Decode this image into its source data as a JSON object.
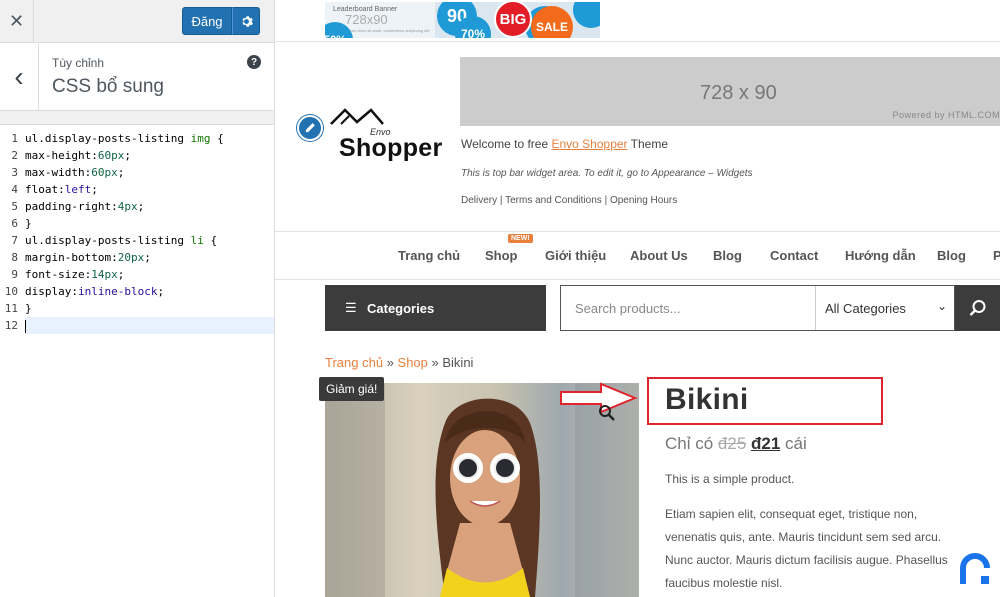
{
  "customizer": {
    "close_glyph": "✕",
    "publish_label": "Đăng",
    "breadcrumb": "Tùy chỉnh",
    "section_title": "CSS bổ sung",
    "help_glyph": "?",
    "back_glyph": "‹"
  },
  "css_editor": {
    "line_numbers": [
      "1",
      "2",
      "3",
      "4",
      "5",
      "6",
      "7",
      "8",
      "9",
      "10",
      "11",
      "12"
    ],
    "lines": [
      "ul.display-posts-listing img {",
      "max-height:60px;",
      "max-width:60px;",
      "float:left;",
      "padding-right:4px;",
      "}",
      "ul.display-posts-listing li {",
      "margin-bottom:20px;",
      "font-size:14px;",
      "display:inline-block;",
      "}",
      ""
    ],
    "current_line": 12
  },
  "preview": {
    "leaderboard": {
      "title": "Leaderboard Banner",
      "size": "728x90",
      "fine_print": "Lorem ipsum dolor sit amet, consectetur adipiscing elit.",
      "discounts": [
        "50%",
        "90",
        "70%",
        "BIG",
        "SALE",
        "%"
      ]
    },
    "logo": {
      "brand": "Shopper",
      "envo": "Envo"
    },
    "header_banner": {
      "size": "728 x 90",
      "credit": "Powered by HTML.COM"
    },
    "welcome": {
      "prefix": "Welcome to free ",
      "link": "Envo Shopper",
      "suffix": " Theme"
    },
    "topbar_note": "This is top bar widget area. To edit it, go to Appearance – Widgets",
    "top_links": "Delivery | Terms and Conditions | Opening Hours",
    "nav": {
      "items": [
        "Trang chủ",
        "Shop",
        "Giới thiệu",
        "About Us",
        "Blog",
        "Contact",
        "Hướng dẫn",
        "Blog",
        "P"
      ],
      "badge": "NEW!"
    },
    "categories_label": "Categories",
    "search": {
      "placeholder": "Search products...",
      "category_select": "All Categories"
    },
    "breadcrumb": {
      "home": "Trang chủ",
      "sep1": " » ",
      "shop": "Shop",
      "sep2": " » ",
      "current": "Bikini"
    },
    "product": {
      "sale_badge": "Giảm giá!",
      "title": "Bikini",
      "price_prefix": "Chỉ có ",
      "old_price": "đ25",
      "new_price": "đ21",
      "price_suffix": " cái",
      "short_description": "This is a simple product.",
      "long_description": "Etiam sapien elit, consequat eget, tristique non, venenatis quis, ante. Mauris tincidunt sem sed arcu. Nunc auctor. Mauris dictum facilisis augue. Phasellus faucibus molestie nisl."
    }
  },
  "colors": {
    "wp_blue": "#2271b1",
    "accent_orange": "#e77f3d",
    "annotation_red": "#e0232c",
    "dark_bar": "#3c3c3c"
  }
}
